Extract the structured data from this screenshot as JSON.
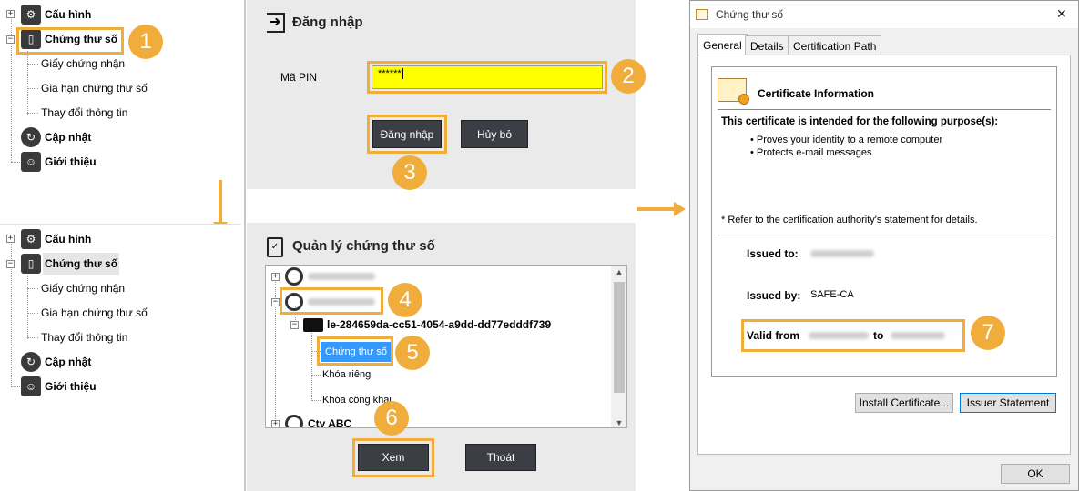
{
  "tree": {
    "items": [
      {
        "label": "Cấu hình"
      },
      {
        "label": "Chứng thư số"
      },
      {
        "label": "Giấy chứng nhận"
      },
      {
        "label": "Gia hạn chứng thư số"
      },
      {
        "label": "Thay đổi thông tin"
      },
      {
        "label": "Cập nhật"
      },
      {
        "label": "Giới thiệu"
      }
    ]
  },
  "login": {
    "title": "Đăng nhập",
    "pin_label": "Mã PIN",
    "pin_value": "******",
    "login_button": "Đăng nhập",
    "cancel_button": "Hủy bỏ"
  },
  "manager": {
    "title": "Quản lý chứng thư số",
    "container_name": "le-284659da-cc51-4054-a9dd-dd77edddf739",
    "cert_item": "Chứng thư số",
    "private_key": "Khóa riêng",
    "public_key": "Khóa công khai",
    "company": "Cty ABC",
    "view_button": "Xem",
    "exit_button": "Thoát"
  },
  "badges": [
    "1",
    "2",
    "3",
    "4",
    "5",
    "6",
    "7"
  ],
  "dialog": {
    "title": "Chứng thư số",
    "tabs": [
      "General",
      "Details",
      "Certification Path"
    ],
    "info_heading": "Certificate Information",
    "purpose_heading": "This certificate is intended for the following purpose(s):",
    "purposes": [
      "• Proves your identity to a remote computer",
      "• Protects e-mail messages"
    ],
    "refer_note": "* Refer to the certification authority's statement for details.",
    "issued_to_label": "Issued to:",
    "issued_by_label": "Issued by:",
    "issued_by_value": "SAFE-CA",
    "valid_from_label": "Valid from",
    "valid_to_label": "to",
    "install_button": "Install Certificate...",
    "issuer_button": "Issuer Statement",
    "ok_button": "OK",
    "close_glyph": "✕"
  },
  "colors": {
    "accent": "#f0ad3c",
    "pin_field": "#ffff00",
    "selected": "#3399ff",
    "dark_button": "#3b3f45"
  }
}
